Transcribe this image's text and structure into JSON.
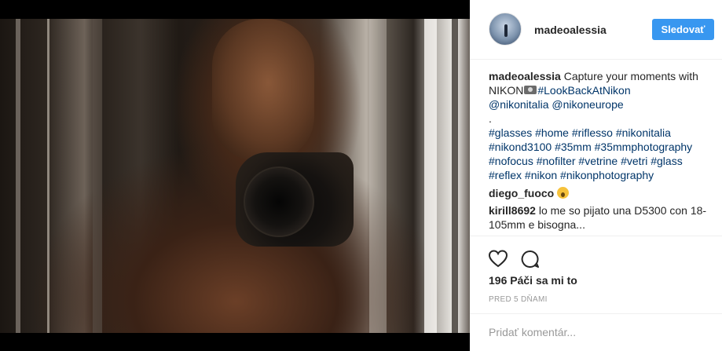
{
  "post": {
    "username": "madeoalessia",
    "follow_label": "Sledovať",
    "caption": {
      "username": "madeoalessia",
      "text_before": "Capture your moments with NIKON",
      "emoji": "camera-emoji",
      "tag_lookback": "#LookBackAtNikon",
      "mentions": "@nikonitalia @nikoneurope",
      "dot": ".",
      "hashtags": "#glasses #home #riflesso #nikonitalia #nikond3100 #35mm #35mmphotography #nofocus #nofilter #vetrine #vetri #glass #reflex #nikon #nikonphotography"
    },
    "comments": [
      {
        "username": "diego_fuoco",
        "text": "",
        "emoji": "surprised-face-emoji"
      },
      {
        "username": "kirill8692",
        "text": "lo me so pijato una D5300 con 18-105mm e bisogna..."
      }
    ],
    "likes": "196 Páči sa mi to",
    "timestamp": "PRED 5 DŇAMI",
    "comment_placeholder": "Pridať komentár..."
  },
  "colors": {
    "follow_button": "#3897f0",
    "link": "#003569",
    "muted": "#999999"
  },
  "icons": [
    "heart-icon",
    "comment-icon",
    "camera-emoji",
    "surprised-face-emoji"
  ]
}
